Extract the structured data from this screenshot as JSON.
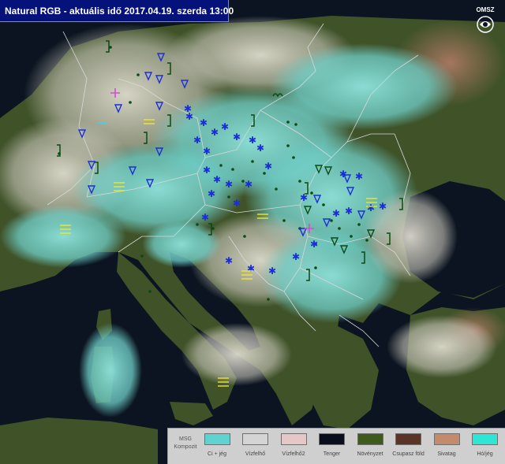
{
  "header": {
    "title": "Natural RGB - aktuális idő 2017.04.19. szerda 13:00",
    "logo_text": "OMSZ"
  },
  "legend": {
    "head_line1": "MSG",
    "head_line2": "Kompozit",
    "items": [
      {
        "label": "Ci + jég",
        "color": "#5fd3d2"
      },
      {
        "label": "Vízfelhő",
        "color": "#d4d4d4"
      },
      {
        "label": "Vízfelhő2",
        "color": "#e6c6c6"
      },
      {
        "label": "Tenger",
        "color": "#0a0d1a"
      },
      {
        "label": "Növényzet",
        "color": "#3e5a1c"
      },
      {
        "label": "Csupasz föld",
        "color": "#5a3426"
      },
      {
        "label": "Sivatag",
        "color": "#c48a6c"
      },
      {
        "label": "Hó/jég",
        "color": "#2ee6d6"
      }
    ]
  },
  "map_colors": {
    "sea": "#0b1420",
    "land": "#3f5228",
    "cloud_cyan": "#7fd6d0",
    "cloud_white": "#d9d7cf",
    "borders": "#d8d8d8",
    "symbol_snow": "#1a2fd6",
    "symbol_rain": "#0b4a12",
    "symbol_fog": "#f0e62a",
    "symbol_other": "#d050d0"
  }
}
